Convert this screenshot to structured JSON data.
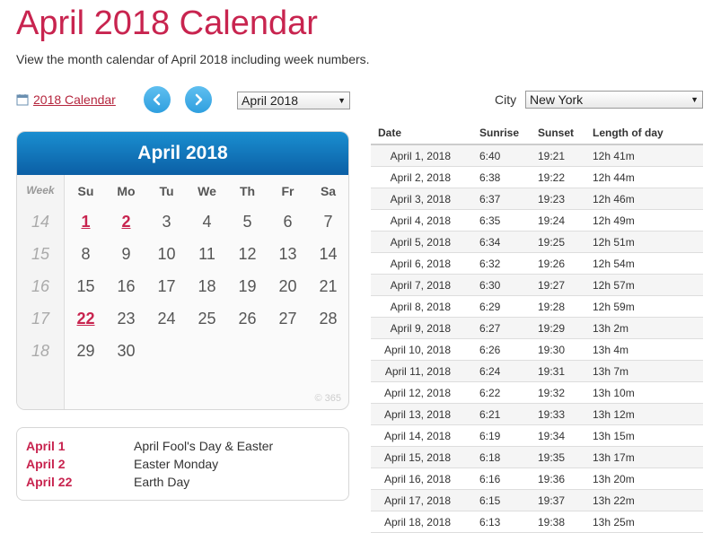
{
  "page": {
    "title": "April 2018 Calendar",
    "subtitle": "View the month calendar of April 2018 including week numbers."
  },
  "nav": {
    "calendar_link": "2018 Calendar",
    "month_select": "April 2018",
    "city_label": "City",
    "city_select": "New York"
  },
  "calendar": {
    "title": "April 2018",
    "week_header": "Week",
    "day_headers": [
      "Su",
      "Mo",
      "Tu",
      "We",
      "Th",
      "Fr",
      "Sa"
    ],
    "weeks": [
      {
        "week": "14",
        "days": [
          "1",
          "2",
          "3",
          "4",
          "5",
          "6",
          "7"
        ]
      },
      {
        "week": "15",
        "days": [
          "8",
          "9",
          "10",
          "11",
          "12",
          "13",
          "14"
        ]
      },
      {
        "week": "16",
        "days": [
          "15",
          "16",
          "17",
          "18",
          "19",
          "20",
          "21"
        ]
      },
      {
        "week": "17",
        "days": [
          "22",
          "23",
          "24",
          "25",
          "26",
          "27",
          "28"
        ]
      },
      {
        "week": "18",
        "days": [
          "29",
          "30",
          "",
          "",
          "",
          "",
          ""
        ]
      }
    ],
    "holiday_days": [
      "1",
      "2",
      "22"
    ],
    "watermark": "© 365"
  },
  "holidays": [
    {
      "date": "April 1",
      "name": "April Fool's Day & Easter"
    },
    {
      "date": "April 2",
      "name": "Easter Monday"
    },
    {
      "date": "April 22",
      "name": "Earth Day"
    }
  ],
  "sun_table": {
    "headers": [
      "Date",
      "Sunrise",
      "Sunset",
      "Length of day"
    ],
    "rows": [
      [
        "April 1, 2018",
        "6:40",
        "19:21",
        "12h 41m"
      ],
      [
        "April 2, 2018",
        "6:38",
        "19:22",
        "12h 44m"
      ],
      [
        "April 3, 2018",
        "6:37",
        "19:23",
        "12h 46m"
      ],
      [
        "April 4, 2018",
        "6:35",
        "19:24",
        "12h 49m"
      ],
      [
        "April 5, 2018",
        "6:34",
        "19:25",
        "12h 51m"
      ],
      [
        "April 6, 2018",
        "6:32",
        "19:26",
        "12h 54m"
      ],
      [
        "April 7, 2018",
        "6:30",
        "19:27",
        "12h 57m"
      ],
      [
        "April 8, 2018",
        "6:29",
        "19:28",
        "12h 59m"
      ],
      [
        "April 9, 2018",
        "6:27",
        "19:29",
        "13h 2m"
      ],
      [
        "April 10, 2018",
        "6:26",
        "19:30",
        "13h 4m"
      ],
      [
        "April 11, 2018",
        "6:24",
        "19:31",
        "13h 7m"
      ],
      [
        "April 12, 2018",
        "6:22",
        "19:32",
        "13h 10m"
      ],
      [
        "April 13, 2018",
        "6:21",
        "19:33",
        "13h 12m"
      ],
      [
        "April 14, 2018",
        "6:19",
        "19:34",
        "13h 15m"
      ],
      [
        "April 15, 2018",
        "6:18",
        "19:35",
        "13h 17m"
      ],
      [
        "April 16, 2018",
        "6:16",
        "19:36",
        "13h 20m"
      ],
      [
        "April 17, 2018",
        "6:15",
        "19:37",
        "13h 22m"
      ],
      [
        "April 18, 2018",
        "6:13",
        "19:38",
        "13h 25m"
      ]
    ]
  },
  "colors": {
    "accent": "#c8244f",
    "header_blue": "#0b5fa5"
  }
}
